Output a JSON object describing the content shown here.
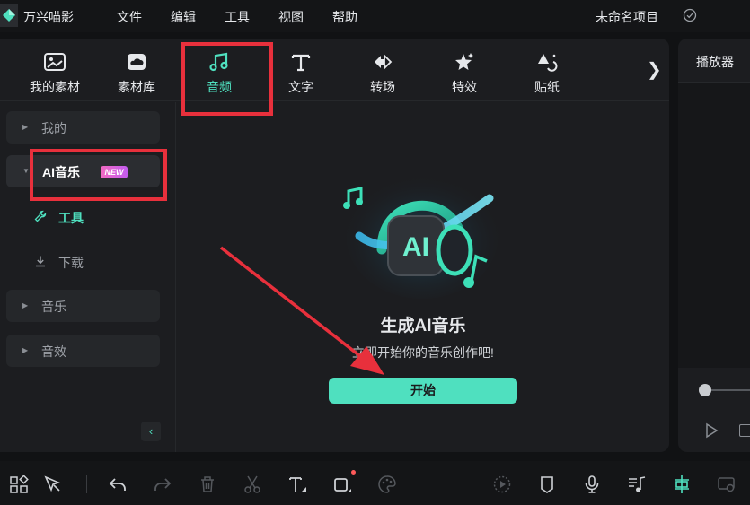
{
  "app": {
    "name": "万兴喵影",
    "project_name": "未命名项目"
  },
  "menu": [
    "文件",
    "编辑",
    "工具",
    "视图",
    "帮助"
  ],
  "tabs": [
    {
      "label": "我的素材",
      "icon": "my-media-icon"
    },
    {
      "label": "素材库",
      "icon": "stock-cloud-icon"
    },
    {
      "label": "音频",
      "icon": "music-note-icon",
      "active": true
    },
    {
      "label": "文字",
      "icon": "text-t-icon"
    },
    {
      "label": "转场",
      "icon": "transition-icon"
    },
    {
      "label": "特效",
      "icon": "effects-star-icon"
    },
    {
      "label": "贴纸",
      "icon": "sticker-icon"
    }
  ],
  "sidebar": {
    "items": [
      {
        "label": "我的"
      },
      {
        "label": "AI音乐",
        "badge": "NEW"
      },
      {
        "label": "音乐"
      },
      {
        "label": "音效"
      }
    ],
    "sub_items": [
      {
        "label": "工具",
        "icon": "wrench-icon",
        "active": true
      },
      {
        "label": "下载",
        "icon": "download-icon"
      }
    ]
  },
  "content": {
    "title": "生成AI音乐",
    "subtitle": "立即开始你的音乐创作吧!",
    "start_button": "开始",
    "illustration_text": "AI"
  },
  "player": {
    "label": "播放器"
  },
  "colors": {
    "accent": "#4fe0bf",
    "annotation": "#e8303c",
    "background": "#1c1d20"
  },
  "toolbar_icons": [
    "layout-grid-icon",
    "select-pointer-icon",
    "undo-icon",
    "redo-icon",
    "delete-icon",
    "scissors-icon",
    "text-tool-icon",
    "crop-icon",
    "color-palette-icon",
    "speed-icon",
    "marker-icon",
    "microphone-icon",
    "music-track-icon",
    "ai-snap-icon",
    "preview-screen-icon"
  ]
}
